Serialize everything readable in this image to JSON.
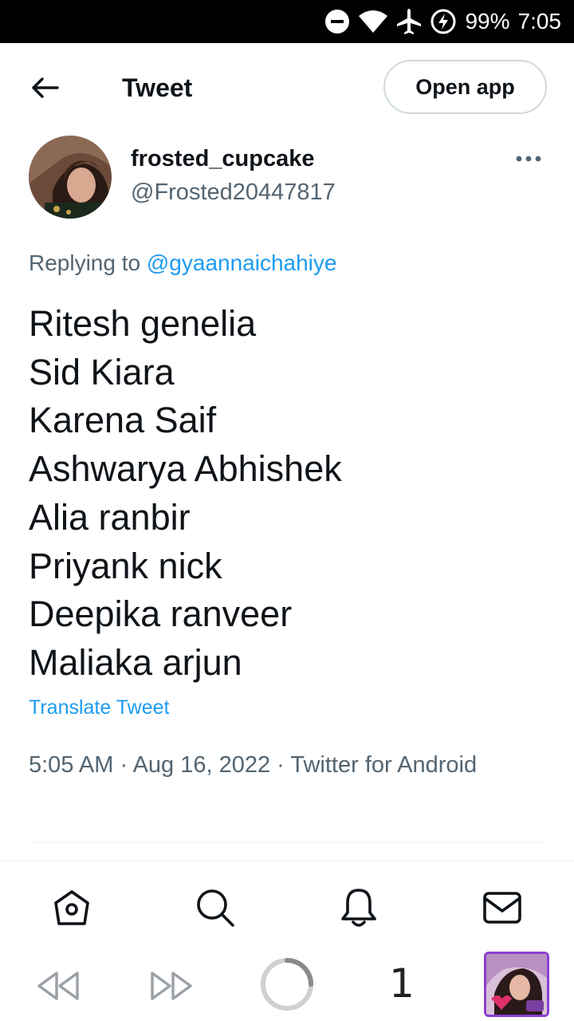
{
  "status_bar": {
    "battery": "99%",
    "time": "7:05"
  },
  "header": {
    "title": "Tweet",
    "open_app_label": "Open app"
  },
  "tweet": {
    "display_name": "frosted_cupcake",
    "handle": "@Frosted20447817",
    "replying_prefix": "Replying to ",
    "replying_to": "@gyaannaichahiye",
    "lines": [
      "Ritesh genelia",
      "Sid Kiara",
      "Karena Saif",
      "Ashwarya Abhishek",
      "Alia ranbir",
      "Priyank nick",
      "Deepika ranveer",
      "Maliaka arjun"
    ],
    "translate_label": "Translate Tweet",
    "meta": "5:05 AM · Aug 16, 2022 · Twitter for Android"
  },
  "bottom_nav": [
    "home-icon",
    "search-icon",
    "notifications-icon",
    "messages-icon"
  ],
  "browser_bar": {
    "tab_count": "1"
  },
  "colors": {
    "accent": "#1d9bf0",
    "text": "#0f1419",
    "secondary": "#536471",
    "border": "#cfd9de"
  }
}
